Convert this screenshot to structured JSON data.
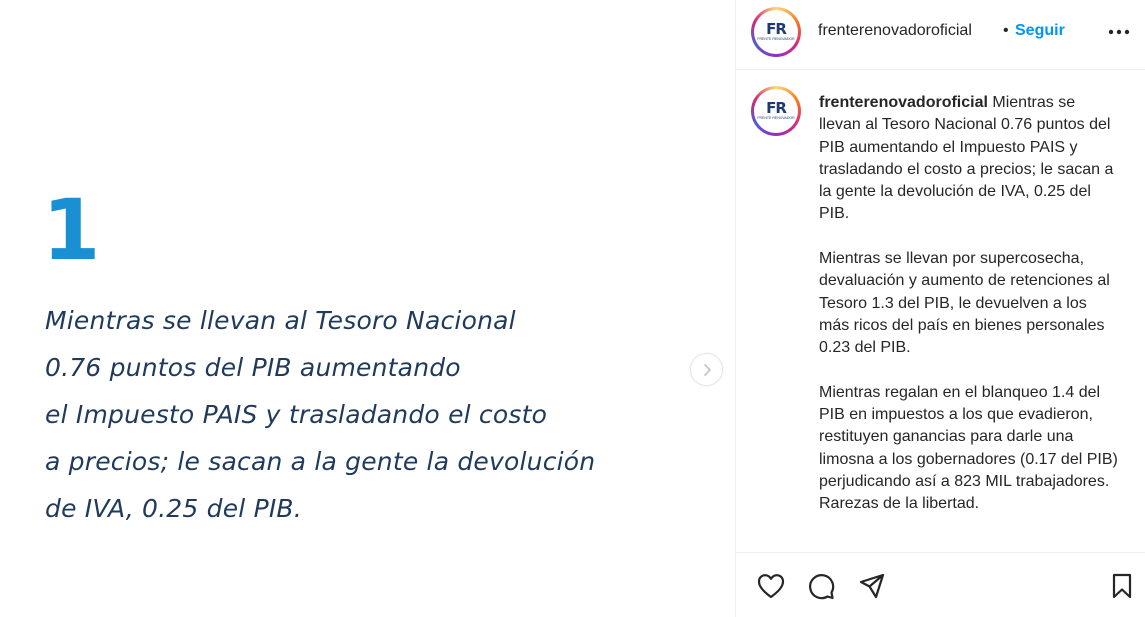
{
  "post": {
    "slide_number": "1",
    "slide_lines": [
      "Mientras se llevan al Tesoro Nacional",
      "0.76 puntos del PIB aumentando",
      "el Impuesto PAIS y trasladando el costo",
      "a precios; le sacan a la gente la devolución",
      "de IVA, 0.25 del PIB."
    ],
    "next_icon": "chevron-right-icon"
  },
  "header": {
    "avatar_logo": "FR",
    "avatar_sub": "FRENTE RENOVADOR",
    "username": "frenterenovadoroficial",
    "separator": "•",
    "follow_label": "Seguir",
    "more_icon": "more-horizontal-icon"
  },
  "caption": {
    "username": "frenterenovadoroficial",
    "paragraph_1": "Mientras se llevan al Tesoro Nacional 0.76 puntos del PIB aumentando el Impuesto PAIS y trasladando el costo a precios; le sacan a la gente la devolución de IVA, 0.25 del PIB.",
    "paragraph_2": "Mientras se llevan por supercosecha, devaluación y aumento de retenciones al Tesoro 1.3 del PIB, le devuelven a los más ricos del país en bienes personales 0.23 del PIB.",
    "paragraph_3": "Mientras regalan en el blanqueo 1.4 del PIB en impuestos a los que evadieron, restituyen ganancias para darle una limosna a los gobernadores (0.17 del PIB) perjudicando así a 823 MIL trabajadores.",
    "paragraph_4": "Rarezas de la libertad."
  },
  "actions": {
    "icons": [
      "heart-icon",
      "comment-icon",
      "share-icon",
      "bookmark-icon"
    ]
  },
  "colors": {
    "slide_number": "#1a8fd1",
    "slide_text": "#1f3a5a",
    "follow": "#0095f6",
    "text": "#262626",
    "divider": "#efefef"
  }
}
